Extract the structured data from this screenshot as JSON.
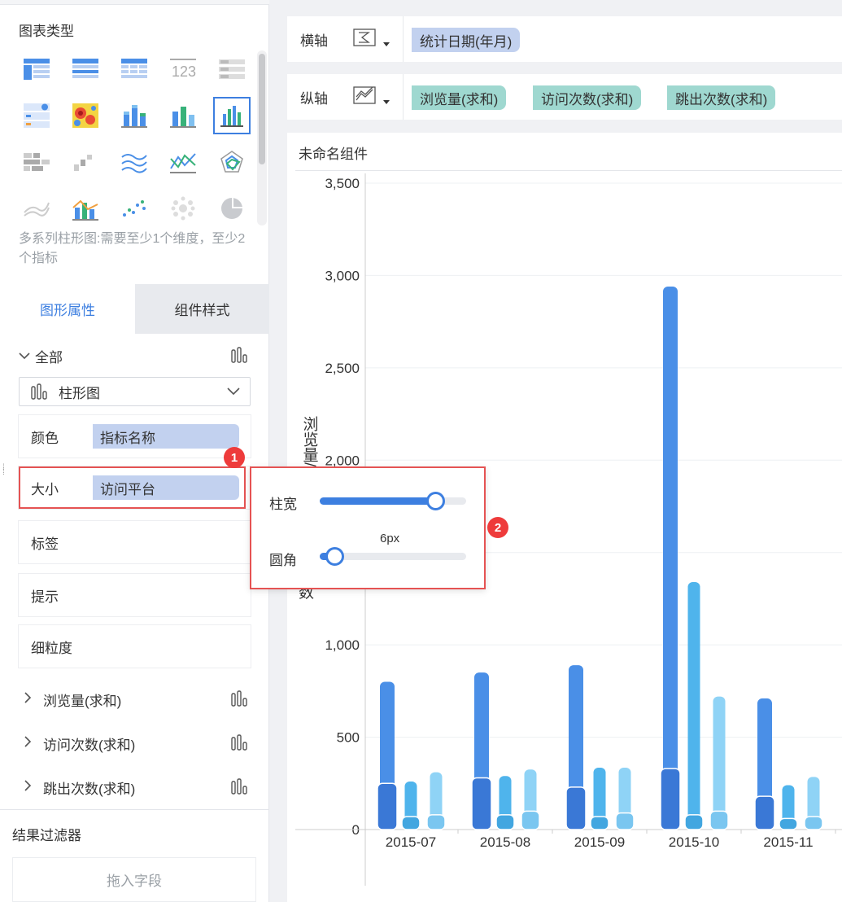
{
  "left_panel": {
    "chart_type_title": "图表类型",
    "chart_type_hint": "多系列柱形图:需要至少1个维度，至少2个指标",
    "chart_type_icons": [
      "cross-table-icon",
      "detail-table-icon",
      "group-table-icon",
      "kpi-number-icon",
      "text-table-icon",
      "dashboard-list-icon",
      "heatmap-icon",
      "stacked-bar-icon",
      "multi-bar-icon",
      "multi-series-bar-icon",
      "pareto-icon",
      "scatter-step-icon",
      "area-line-icon",
      "line-icon",
      "radar-icon",
      "stream-line-icon",
      "combo-bar-line-icon",
      "dot-scatter-icon",
      "bubble-icon",
      "pie-icon"
    ],
    "tabs": {
      "graph_props": "图形属性",
      "component_style": "组件样式"
    },
    "all_label": "全部",
    "chart_select": "柱形图",
    "properties": {
      "color_label": "颜色",
      "color_field": "指标名称",
      "size_label": "大小",
      "size_field": "访问平台",
      "label_label": "标签",
      "tooltip_label": "提示",
      "granularity_label": "细粒度"
    },
    "measures": [
      "浏览量(求和)",
      "访问次数(求和)",
      "跳出次数(求和)"
    ],
    "filter_title": "结果过滤器",
    "drop_zone": "拖入字段",
    "badge1": "1",
    "badge2": "2"
  },
  "axes": {
    "x_label": "横轴",
    "x_fields": [
      "统计日期(年月)"
    ],
    "y_label": "纵轴",
    "y_fields": [
      "浏览量(求和)",
      "访问次数(求和)",
      "跳出次数(求和)"
    ]
  },
  "popup": {
    "bar_width_label": "柱宽",
    "bar_width_value": 0.79,
    "radius_label": "圆角",
    "radius_value_text": "6px",
    "radius_value": 0.1
  },
  "component": {
    "title": "未命名组件",
    "ylabel_visible_fragment_top": "浏览量/访",
    "ylabel_visible_fragment_bottom": "数"
  },
  "chart_data": {
    "type": "bar",
    "categories": [
      "2015-07",
      "2015-08",
      "2015-09",
      "2015-10",
      "2015-11"
    ],
    "ylim": [
      0,
      3500
    ],
    "yticks": [
      "0",
      "500",
      "1,000",
      "1,500",
      "2,000",
      "2,500",
      "3,000",
      "3,500"
    ],
    "series": [
      {
        "values": [
          800,
          850,
          890,
          2940,
          710
        ]
      },
      {
        "values": [
          260,
          290,
          335,
          1340,
          240
        ]
      },
      {
        "values": [
          310,
          325,
          335,
          720,
          285
        ]
      }
    ],
    "stacked_segments": [
      [
        250,
        280,
        230,
        330,
        180
      ],
      [
        70,
        80,
        70,
        80,
        60
      ],
      [
        80,
        100,
        90,
        100,
        70
      ]
    ],
    "colors": [
      "#4a8fe7",
      "#4fb4ec",
      "#8fd3f6"
    ],
    "grid": true
  }
}
